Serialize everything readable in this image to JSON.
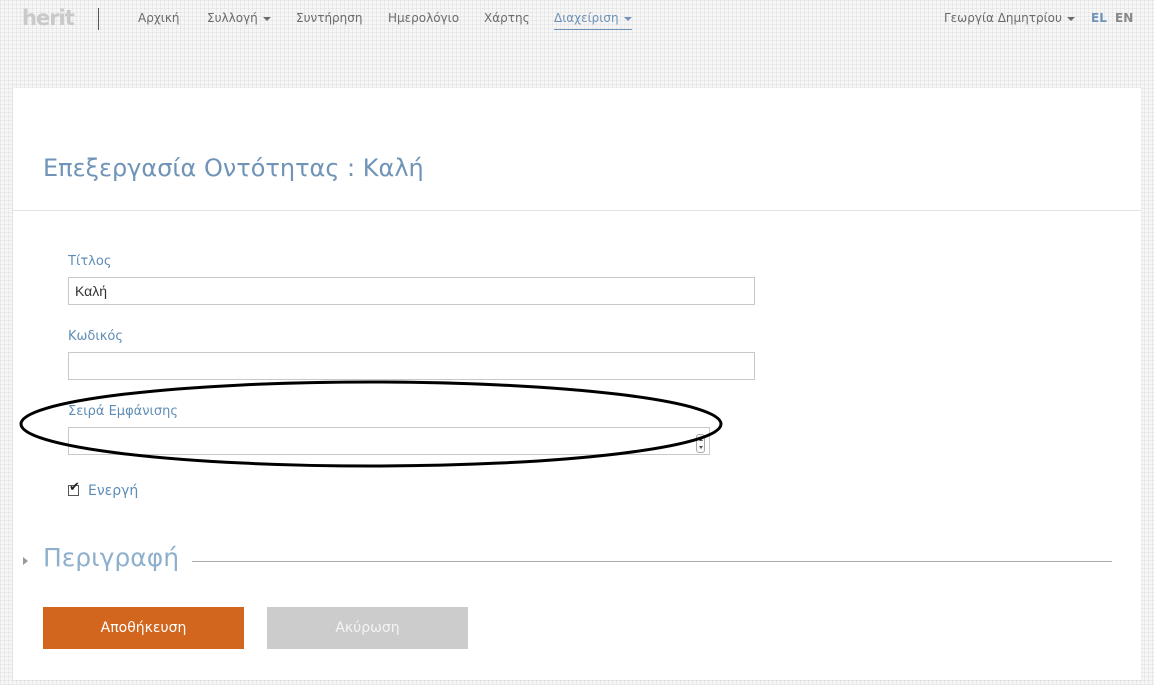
{
  "nav": {
    "logo": "herit",
    "items": [
      {
        "label": "Αρχική",
        "dropdown": false,
        "active": false
      },
      {
        "label": "Συλλογή",
        "dropdown": true,
        "active": false
      },
      {
        "label": "Συντήρηση",
        "dropdown": false,
        "active": false
      },
      {
        "label": "Ημερολόγιο",
        "dropdown": false,
        "active": false
      },
      {
        "label": "Χάρτης",
        "dropdown": false,
        "active": false
      },
      {
        "label": "Διαχείριση",
        "dropdown": true,
        "active": true
      }
    ],
    "user": "Γεωργία Δημητρίου",
    "languages": [
      {
        "code": "EL",
        "active": true
      },
      {
        "code": "EN",
        "active": false
      }
    ]
  },
  "page": {
    "title": "Επεξεργασία Οντότητας : Καλή"
  },
  "form": {
    "title_label": "Τίτλος",
    "title_value": "Καλή",
    "code_label": "Κωδικός",
    "code_value": "",
    "order_label": "Σειρά Εμφάνισης",
    "order_value": "",
    "active_label": "Ενεργή",
    "active_checked": true
  },
  "description": {
    "title": "Περιγραφή",
    "collapsed": true
  },
  "actions": {
    "save_label": "Αποθήκευση",
    "cancel_label": "Ακύρωση"
  },
  "colors": {
    "accent": "#6f94b7",
    "primary_button": "#d2661e",
    "secondary_button": "#cccccc",
    "active_lang": "#6f94b7",
    "inactive_lang": "#888888"
  }
}
